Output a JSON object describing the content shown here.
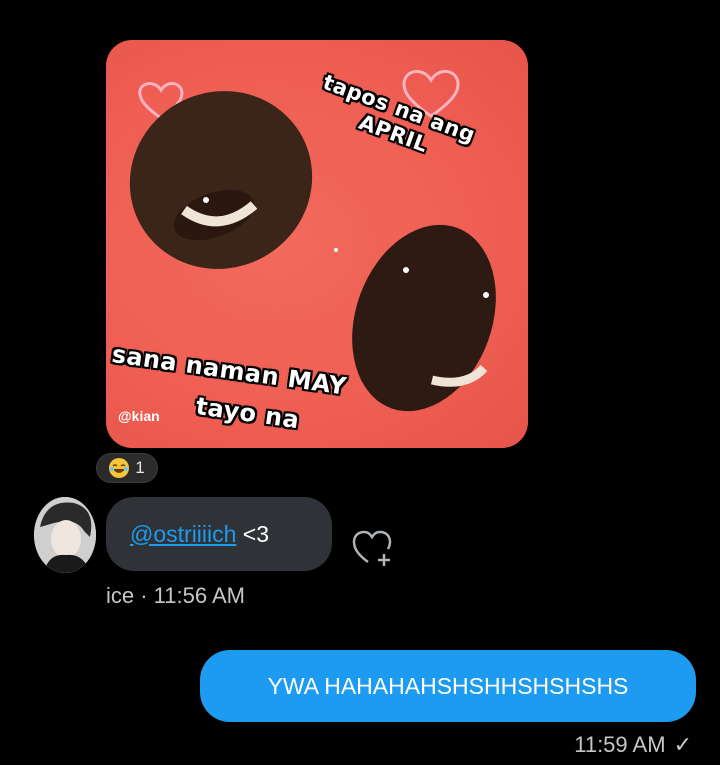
{
  "meme": {
    "text_top_line1": "tapos na ang",
    "text_top_line2": "APRIL",
    "text_bottom_line1": "sana naman MAY",
    "text_bottom_line2": "tayo na",
    "watermark": "@kian"
  },
  "reaction": {
    "emoji": "laughing-with-tears-emoji",
    "count": "1"
  },
  "incoming_message": {
    "mention": "@ostriiiich",
    "text": " <3",
    "sender": "ice",
    "time": "11:56 AM",
    "meta": "ice · 11:56 AM"
  },
  "outgoing_message": {
    "text": "YWA HAHAHAHSHSHHSHSHSHS",
    "time": "11:59 AM",
    "status": "✓"
  },
  "colors": {
    "background": "#000000",
    "incoming_bubble": "#2f3236",
    "outgoing_bubble": "#1d9bf0",
    "meme_background": "#ef5f54"
  }
}
